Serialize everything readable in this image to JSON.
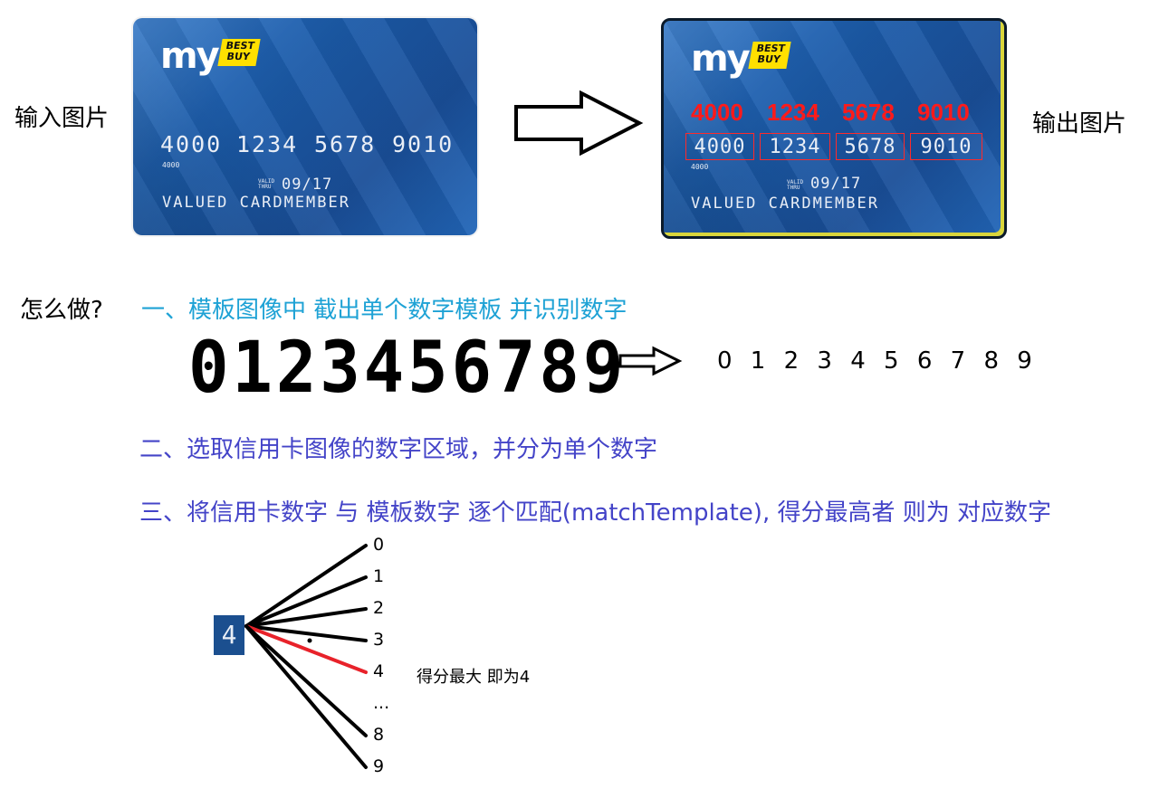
{
  "labels": {
    "input": "输入图片",
    "output": "输出图片",
    "how": "怎么做?"
  },
  "card": {
    "logo_my": "my",
    "logo_brand": "BEST BUY",
    "number_groups": [
      "4000",
      "1234",
      "5678",
      "9010"
    ],
    "small_number": "4000",
    "valid_thru": "VALID THRU",
    "expiry": "09/17",
    "name": "VALUED CARDMEMBER"
  },
  "output_card": {
    "recognized": [
      "4000",
      "1234",
      "5678",
      "9010"
    ]
  },
  "steps": [
    "一、模板图像中 截出单个数字模板 并识别数字",
    "二、选取信用卡图像的数字区域，并分为单个数字",
    "三、将信用卡数字 与 模板数字 逐个匹配(matchTemplate), 得分最高者 则为 对应数字"
  ],
  "template": {
    "ocr_digits": "0123456789",
    "recognized_digits": "0 1 2 3 4 5 6 7 8 9"
  },
  "matching": {
    "source_digit": "4",
    "candidates": [
      "0",
      "1",
      "2",
      "3",
      "4",
      "...",
      "8",
      "9"
    ],
    "best_index": 4,
    "result": "得分最大 即为4"
  },
  "colors": {
    "highlight": "#e8222a",
    "line": "#000000",
    "step1": "#1ea2d5",
    "step23": "#4444c8"
  }
}
